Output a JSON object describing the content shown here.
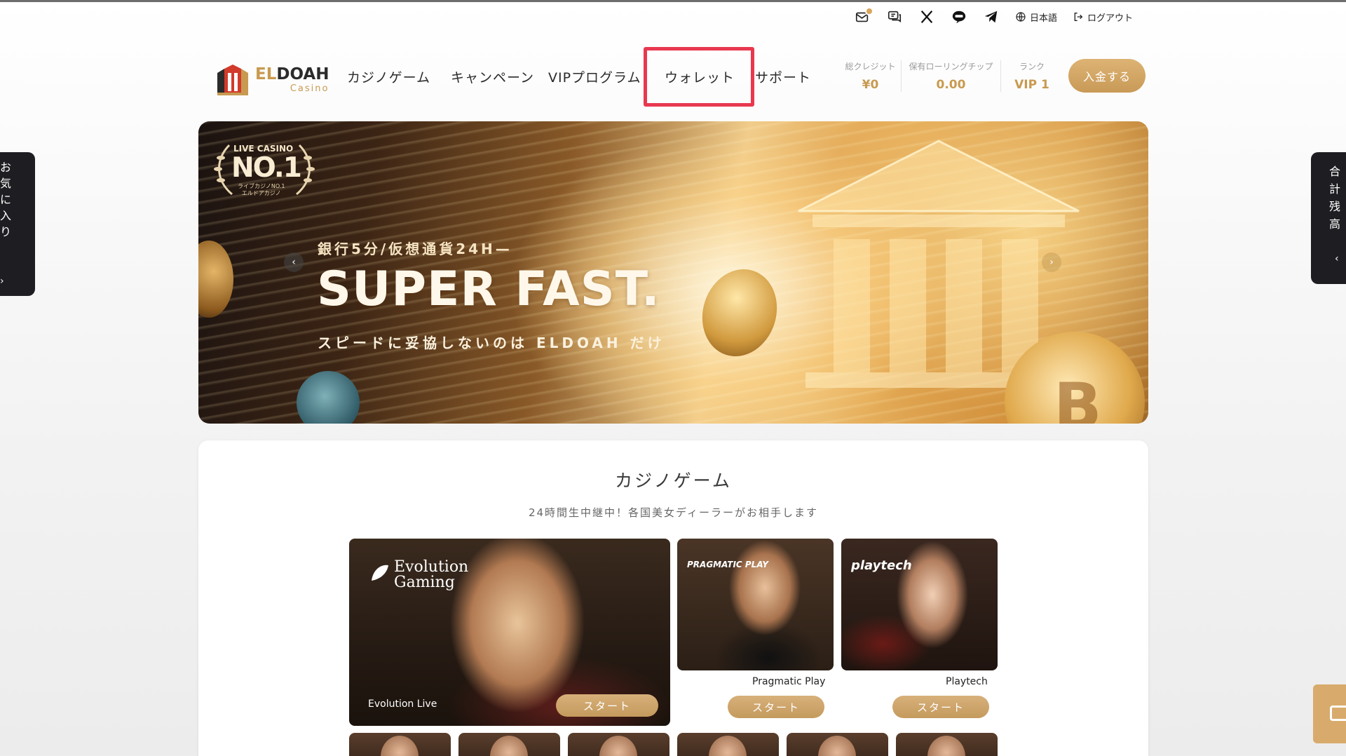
{
  "utility": {
    "language": "日本語",
    "logout": "ログアウト",
    "icons": [
      "mail-icon",
      "chat-icon",
      "x-icon",
      "line-icon",
      "telegram-icon",
      "globe-icon",
      "logout-icon"
    ]
  },
  "logo": {
    "main_dark": "EL",
    "main_rest": "DOAH",
    "sub": "Casino"
  },
  "nav": {
    "items": [
      "カジノゲーム",
      "キャンペーン",
      "VIPプログラム",
      "ウォレット",
      "サポート"
    ],
    "highlighted": "ウォレット"
  },
  "stats": [
    {
      "label": "総クレジット",
      "value": "¥0"
    },
    {
      "label": "保有ローリングチップ",
      "value": "0.00"
    },
    {
      "label": "ランク",
      "value": "VIP 1"
    }
  ],
  "deposit_button": "入金する",
  "side_left": {
    "text": [
      "お",
      "気",
      "に",
      "入",
      "り"
    ],
    "chevron": "›"
  },
  "side_right": {
    "text": [
      "合",
      "計",
      "残",
      "高"
    ],
    "chevron": "‹"
  },
  "banner": {
    "badge_top": "LIVE CASINO",
    "badge_main": "NO.1",
    "badge_sub": "ライブカジノNO.1\nエルドアカジノ",
    "subtitle": "銀行5分/仮想通貨24H—",
    "title": "SUPER FAST.",
    "tagline": "スピードに妥協しないのは ELDOAH だけ",
    "coin_symbol": "B",
    "prev": "‹",
    "next": "›"
  },
  "games": {
    "title": "カジノゲーム",
    "subtitle": "24時間生中継中！各国美女ディーラーがお相手します",
    "cards": [
      {
        "brand_line1": "Evolution",
        "brand_line2": "Gaming",
        "caption": "Evolution Live",
        "button": "スタート"
      },
      {
        "brand": "PRAGMATIC PLAY",
        "label": "Pragmatic Play",
        "button": "スタート"
      },
      {
        "brand": "playtech",
        "label": "Playtech",
        "button": "スタート"
      }
    ]
  },
  "colors": {
    "gold": "#c89a50",
    "highlight": "#e8384f",
    "dark_tab": "#1e1e22"
  }
}
